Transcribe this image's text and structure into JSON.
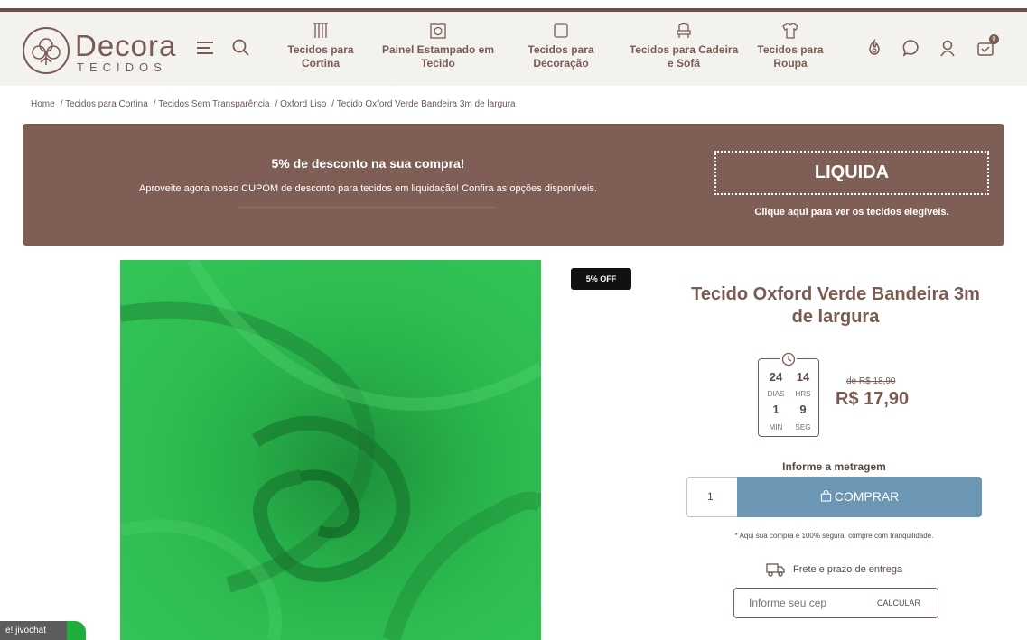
{
  "header": {
    "brand": "Decora",
    "brand_sub": "TECIDOS",
    "nav": [
      {
        "line1": "Tecidos para",
        "line2": "Cortina",
        "icon": "curtain-icon"
      },
      {
        "line1": "Painel Estampado em",
        "line2": "Tecido",
        "icon": "frame-icon"
      },
      {
        "line1": "Tecidos para",
        "line2": "Decoração",
        "icon": "cushion-icon"
      },
      {
        "line1": "Tecidos para Cadeira",
        "line2": "e Sofá",
        "icon": "chair-icon"
      },
      {
        "line1": "Tecidos para",
        "line2": "Roupa",
        "icon": "shirt-icon"
      }
    ],
    "cart_count": "0",
    "icons": [
      "menu-icon",
      "search-icon",
      "flame-icon",
      "chat-icon",
      "user-icon",
      "cart-icon"
    ]
  },
  "breadcrumb": [
    "Home",
    "Tecidos para Cortina",
    "Tecidos Sem Transparência",
    "Oxford Liso",
    "Tecido Oxford Verde Bandeira 3m de largura"
  ],
  "promo": {
    "title": "5% de desconto na sua compra!",
    "text": "Aproveite agora nosso CUPOM de desconto para tecidos em liquidação! Confira as opções disponíveis.",
    "coupon": "LIQUIDA",
    "note": "Clique aqui para ver os tecidos elegíveis."
  },
  "product": {
    "badge": "5% OFF",
    "title_line1": "Tecido Oxford Verde Bandeira 3m",
    "title_line2": "de largura",
    "timer": {
      "days": "24",
      "days_label": "DIAS",
      "hours": "14",
      "hours_label": "HRS",
      "minutes": "1",
      "minutes_label": "MIN",
      "seconds": "9",
      "seconds_label": "SEG"
    },
    "price_old": "de R$ 18,90",
    "price_new": "R$ 17,90",
    "meter_label": "Informe a metragem",
    "quantity": "1",
    "buy_label": "COMPRAR",
    "secure_note": "* Aqui sua compra é 100% segura, compre com tranquilidade.",
    "shipping_label": "Frete e prazo de entrega",
    "cep_placeholder": "Informe seu cep",
    "cep_button": "CALCULAR"
  },
  "chat": {
    "label": "e! jivochat"
  },
  "colors": {
    "brand": "#7a5b52",
    "promo_bg": "#7f5f55",
    "buy_button": "#6b96b4",
    "fabric": "#2fbd52"
  }
}
